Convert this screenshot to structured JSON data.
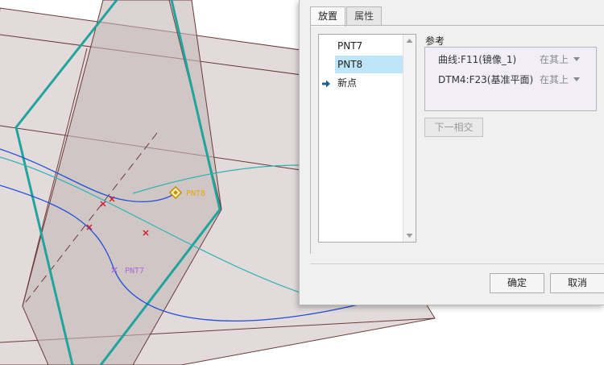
{
  "viewport": {
    "point_labels": [
      "PNT8",
      "PNT7"
    ],
    "colors": {
      "plane_fill": "#cdbfbf",
      "plane_edge": "#6b3a3a",
      "selected_plane_edge": "#21a49b",
      "curve": "#1f4fd8",
      "curve_teal": "#2fb3b0",
      "point_marker": "#d0232f",
      "pnt8": "#e6a517",
      "pnt7": "#a56ad6"
    }
  },
  "dialog": {
    "tabs": [
      "放置",
      "属性"
    ],
    "active_tab": "放置",
    "points": [
      "PNT7",
      "PNT8",
      "新点"
    ],
    "selected_point": "PNT8",
    "references": {
      "label": "参考",
      "rows": [
        {
          "name": "曲线:F11(镜像_1)",
          "type": "在其上"
        },
        {
          "name": "DTM4:F23(基准平面)",
          "type": "在其上"
        }
      ]
    },
    "next_intersection": "下一相交",
    "ok": "确定",
    "cancel": "取消"
  }
}
